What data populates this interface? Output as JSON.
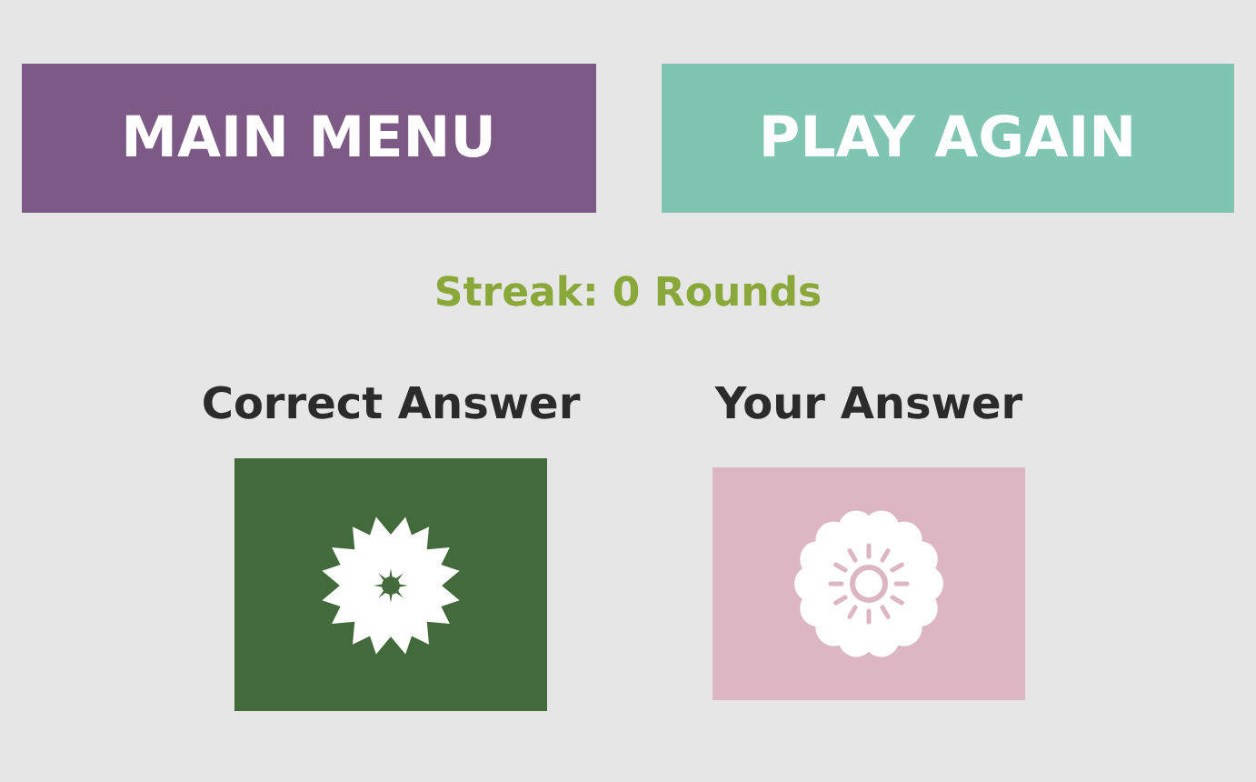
{
  "buttons": [
    {
      "label": "MAIN MENU",
      "color": "#7d5a86"
    },
    {
      "label": "PLAY AGAIN",
      "color": "#80c4b2"
    }
  ],
  "streak": "Streak: 0 Rounds",
  "answers": [
    {
      "heading": "Correct Answer",
      "color": "#436a3b",
      "kind": "star"
    },
    {
      "heading": "Your Answer",
      "color": "#dcb6c2",
      "kind": "daisy"
    }
  ]
}
